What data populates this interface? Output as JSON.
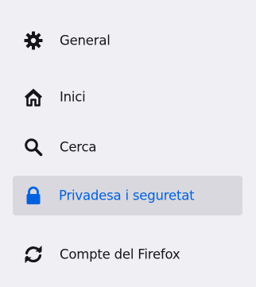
{
  "sidebar": {
    "items": [
      {
        "label": "General",
        "icon": "gear-icon",
        "selected": false
      },
      {
        "label": "Inici",
        "icon": "home-icon",
        "selected": false
      },
      {
        "label": "Cerca",
        "icon": "search-icon",
        "selected": false
      },
      {
        "label": "Privadesa i seguretat",
        "icon": "lock-icon",
        "selected": true
      },
      {
        "label": "Compte del Firefox",
        "icon": "sync-icon",
        "selected": false
      }
    ]
  },
  "colors": {
    "background": "#f0f0f4",
    "selected_background": "#d8d8de",
    "accent": "#0061e0",
    "text": "#15141a"
  }
}
